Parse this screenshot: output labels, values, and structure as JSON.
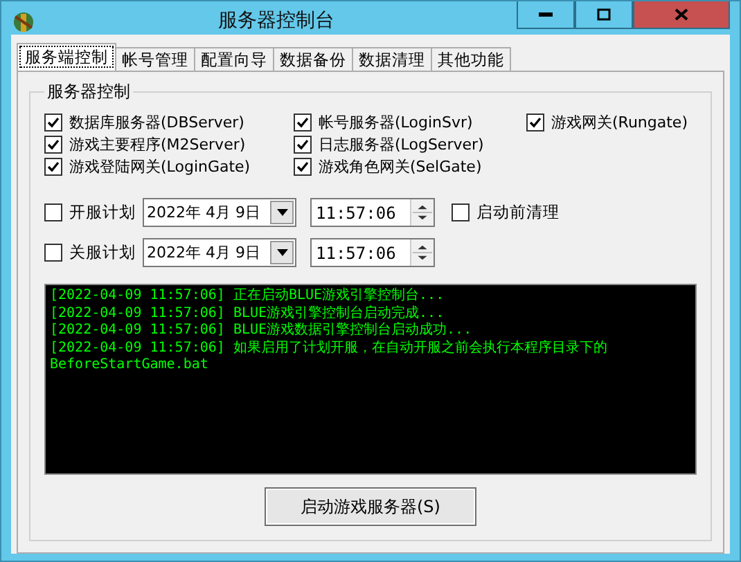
{
  "window": {
    "title": "服务器控制台"
  },
  "tabs": [
    {
      "label": "服务端控制",
      "selected": true
    },
    {
      "label": "帐号管理",
      "selected": false
    },
    {
      "label": "配置向导",
      "selected": false
    },
    {
      "label": "数据备份",
      "selected": false
    },
    {
      "label": "数据清理",
      "selected": false
    },
    {
      "label": "其他功能",
      "selected": false
    }
  ],
  "server_group": {
    "title": "服务器控制",
    "columns": [
      [
        {
          "label": "数据库服务器(DBServer)",
          "checked": true
        },
        {
          "label": "游戏主要程序(M2Server)",
          "checked": true
        },
        {
          "label": "游戏登陆网关(LoginGate)",
          "checked": true
        }
      ],
      [
        {
          "label": "帐号服务器(LoginSvr)",
          "checked": true
        },
        {
          "label": "日志服务器(LogServer)",
          "checked": true
        },
        {
          "label": "游戏角色网关(SelGate)",
          "checked": true
        }
      ],
      [
        {
          "label": "游戏网关(Rungate)",
          "checked": true
        }
      ]
    ]
  },
  "schedules": [
    {
      "label": "开服计划",
      "checked": false,
      "date": "2022年 4月 9日",
      "time": "11:57:06"
    },
    {
      "label": "关服计划",
      "checked": false,
      "date": "2022年 4月 9日",
      "time": "11:57:06"
    }
  ],
  "pre_start_cleanup": {
    "label": "启动前清理",
    "checked": false
  },
  "log": [
    "[2022-04-09 11:57:06] 正在启动BLUE游戏引擎控制台...",
    "[2022-04-09 11:57:06] BLUE游戏引擎控制台启动完成...",
    "[2022-04-09 11:57:06] BLUE游戏数据引擎控制台启动成功...",
    "[2022-04-09 11:57:06] 如果启用了计划开服，在自动开服之前会执行本程序目录下的",
    "BeforeStartGame.bat"
  ],
  "start_button": {
    "label": "启动游戏服务器(S)"
  }
}
